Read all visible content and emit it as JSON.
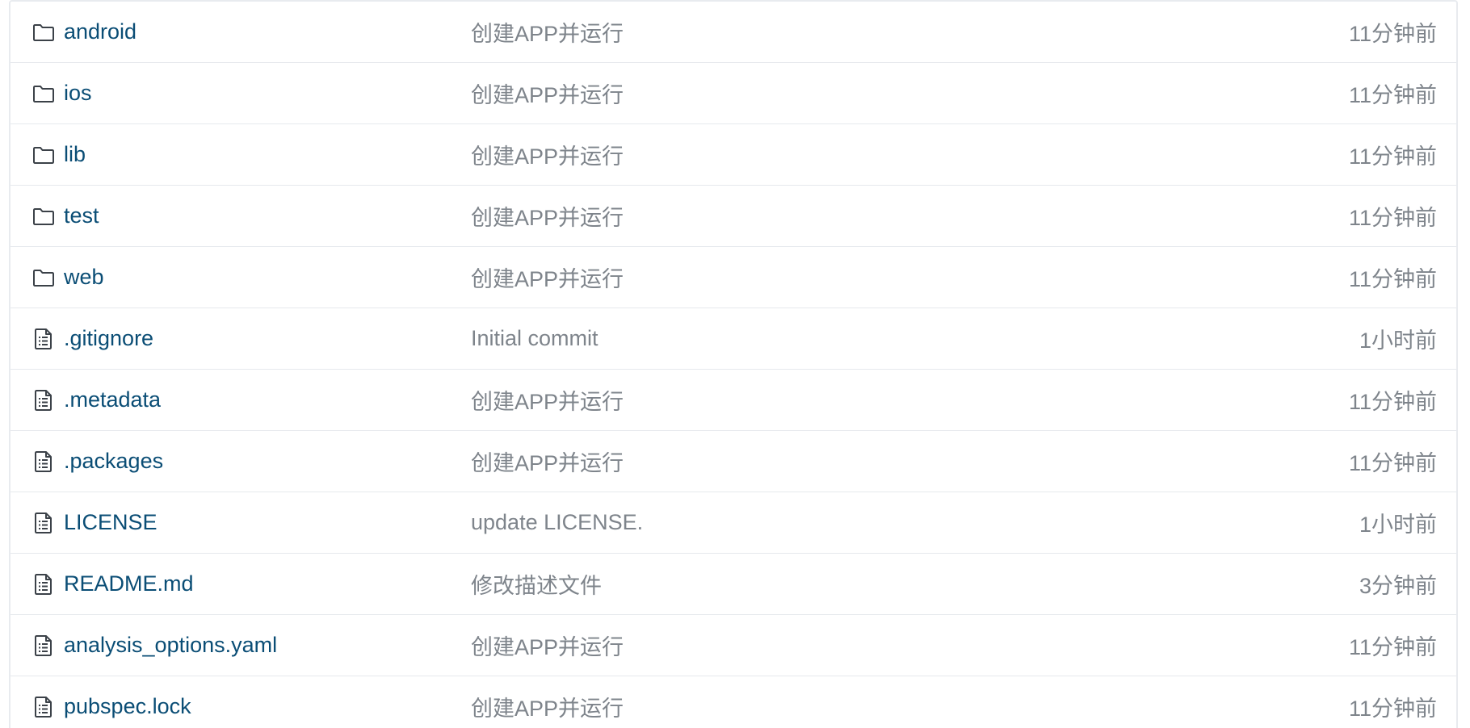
{
  "files": [
    {
      "type": "folder",
      "icon": "folder-icon",
      "name": "android",
      "commit": "创建APP并运行",
      "time": "11分钟前"
    },
    {
      "type": "folder",
      "icon": "folder-icon",
      "name": "ios",
      "commit": "创建APP并运行",
      "time": "11分钟前"
    },
    {
      "type": "folder",
      "icon": "folder-icon",
      "name": "lib",
      "commit": "创建APP并运行",
      "time": "11分钟前"
    },
    {
      "type": "folder",
      "icon": "folder-icon",
      "name": "test",
      "commit": "创建APP并运行",
      "time": "11分钟前"
    },
    {
      "type": "folder",
      "icon": "folder-icon",
      "name": "web",
      "commit": "创建APP并运行",
      "time": "11分钟前"
    },
    {
      "type": "file",
      "icon": "file-icon",
      "name": ".gitignore",
      "commit": "Initial commit",
      "time": "1小时前"
    },
    {
      "type": "file",
      "icon": "file-icon",
      "name": ".metadata",
      "commit": "创建APP并运行",
      "time": "11分钟前"
    },
    {
      "type": "file",
      "icon": "file-icon",
      "name": ".packages",
      "commit": "创建APP并运行",
      "time": "11分钟前"
    },
    {
      "type": "file",
      "icon": "file-icon",
      "name": "LICENSE",
      "commit": "update LICENSE.",
      "time": "1小时前"
    },
    {
      "type": "file",
      "icon": "file-icon",
      "name": "README.md",
      "commit": "修改描述文件",
      "time": "3分钟前"
    },
    {
      "type": "file",
      "icon": "file-icon",
      "name": "analysis_options.yaml",
      "commit": "创建APP并运行",
      "time": "11分钟前"
    },
    {
      "type": "file",
      "icon": "file-icon",
      "name": "pubspec.lock",
      "commit": "创建APP并运行",
      "time": "11分钟前"
    }
  ],
  "colors": {
    "link": "#0a4d75",
    "muted": "#7e848b",
    "border": "#e6e9ed"
  }
}
